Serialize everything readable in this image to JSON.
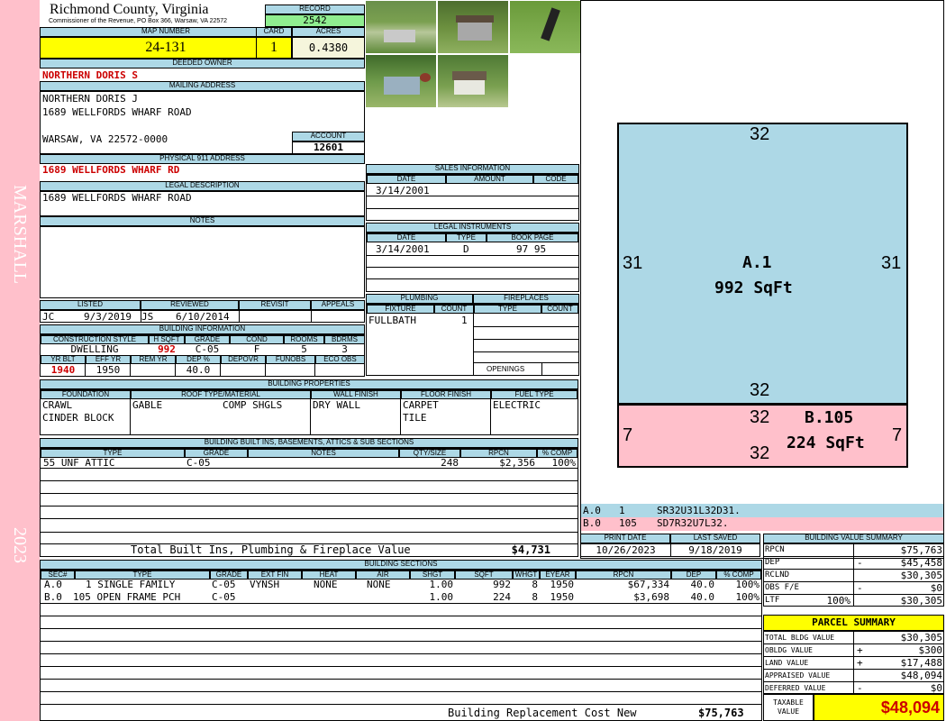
{
  "sidebar": {
    "owner_name": "MARSHALL",
    "year": "2023"
  },
  "header": {
    "county": "Richmond County, Virginia",
    "commissioner": "Commissioner of the Revenue, PO Box 366, Warsaw, VA 22572",
    "record_label": "RECORD",
    "record": "2542",
    "map_label": "MAP NUMBER",
    "map_number": "24-131",
    "card_label": "CARD",
    "card": "1",
    "acres_label": "ACRES",
    "acres": "0.4380"
  },
  "owner": {
    "deeded_label": "DEEDED OWNER",
    "deeded_owner": "NORTHERN DORIS S",
    "mailing_label": "MAILING ADDRESS",
    "mailing": [
      "NORTHERN DORIS J",
      "1689 WELLFORDS WHARF ROAD",
      "",
      "WARSAW, VA 22572-0000"
    ],
    "account_label": "ACCOUNT",
    "account": "12601",
    "physical_label": "PHYSICAL 911 ADDRESS",
    "physical": "1689 WELLFORDS WHARF RD",
    "legal_label": "LEGAL DESCRIPTION",
    "legal": "1689 WELLFORDS WHARF ROAD",
    "notes_label": "NOTES"
  },
  "review": {
    "listed_label": "LISTED",
    "reviewed_label": "REVIEWED",
    "revisit_label": "REVISIT",
    "appeals_label": "APPEALS",
    "listed_by": "JC",
    "listed_date": "9/3/2019",
    "reviewed_by": "JS",
    "reviewed_date": "6/10/2014"
  },
  "building_info": {
    "title": "BUILDING INFORMATION",
    "headers": [
      "CONSTRUCTION STYLE",
      "H SQFT",
      "GRADE",
      "COND",
      "ROOMS",
      "BDRMS"
    ],
    "values": [
      "DWELLING",
      "992",
      "C-05",
      "F",
      "5",
      "3"
    ],
    "headers2": [
      "YR BLT",
      "EFF YR",
      "REM YR",
      "DEP %",
      "DEPOVR",
      "FUNOBS",
      "ECO OBS"
    ],
    "values2": [
      "1940",
      "1950",
      "",
      "40.0",
      "",
      "",
      ""
    ]
  },
  "sales": {
    "title": "SALES INFORMATION",
    "headers": [
      "DATE",
      "AMOUNT",
      "CODE"
    ],
    "rows": [
      [
        "3/14/2001",
        "",
        ""
      ]
    ]
  },
  "legal_instruments": {
    "title": "LEGAL INSTRUMENTS",
    "headers": [
      "DATE",
      "TYPE",
      "BOOK PAGE"
    ],
    "rows": [
      [
        "3/14/2001",
        "D",
        "97 95"
      ]
    ]
  },
  "plumbing": {
    "title": "PLUMBING",
    "headers": [
      "FIXTURE",
      "COUNT"
    ],
    "rows": [
      [
        "FULLBATH",
        "1"
      ]
    ]
  },
  "fireplaces": {
    "title": "FIREPLACES",
    "headers": [
      "TYPE",
      "COUNT"
    ],
    "openings_label": "OPENINGS"
  },
  "properties": {
    "title": "BUILDING PROPERTIES",
    "headers": [
      "FOUNDATION",
      "ROOF TYPE/MATERIAL",
      "WALL FINISH",
      "FLOOR FINISH",
      "FUEL TYPE"
    ],
    "foundation": [
      "CRAWL",
      "CINDER BLOCK"
    ],
    "roof_type": "GABLE",
    "roof_material": "COMP SHGLS",
    "wall": "DRY WALL",
    "floor": [
      "CARPET",
      "TILE"
    ],
    "fuel": "ELECTRIC"
  },
  "builtins": {
    "title": "BUILDING BUILT INS, BASEMENTS, ATTICS & SUB SECTIONS",
    "headers": [
      "TYPE",
      "GRADE",
      "NOTES",
      "QTY/SIZE",
      "RPCN",
      "% COMP"
    ],
    "rows": [
      [
        "55 UNF ATTIC",
        "C-05",
        "",
        "248",
        "$2,356",
        "100%"
      ]
    ],
    "total_label": "Total Built Ins, Plumbing & Fireplace Value",
    "total": "$4,731"
  },
  "sections": {
    "title": "BUILDING SECTIONS",
    "headers": [
      "SEC#",
      "TYPE",
      "GRADE",
      "EXT FIN",
      "HEAT",
      "AIR",
      "SHGT",
      "SQFT",
      "WHGT",
      "EYEAR",
      "RPCN",
      "DEP",
      "% COMP"
    ],
    "rows": [
      [
        "A.0",
        "1 SINGLE FAMILY",
        "C-05",
        "VYNSH",
        "NONE",
        "NONE",
        "1.00",
        "992",
        "8",
        "1950",
        "$67,334",
        "40.0",
        "100%"
      ],
      [
        "B.0",
        "105 OPEN FRAME PCH",
        "C-05",
        "",
        "",
        "",
        "1.00",
        "224",
        "8",
        "1950",
        "$3,698",
        "40.0",
        "100%"
      ]
    ],
    "replacement_label": "Building Replacement Cost New",
    "replacement": "$75,763"
  },
  "sketch": {
    "A": {
      "label": "A.1",
      "area": "992 SqFt",
      "top": "32",
      "left": "31",
      "right": "31",
      "bottom": "32",
      "color": "#add8e6"
    },
    "B": {
      "label": "B.105",
      "area": "224 SqFt",
      "top": "32",
      "left": "7",
      "right": "7",
      "bottom": "32",
      "color": "#ffc0cb"
    },
    "codes": [
      [
        "A.0",
        "1",
        "SR32U31L32D31."
      ],
      [
        "B.0",
        "105",
        "SD7R32U7L32."
      ]
    ]
  },
  "print": {
    "print_label": "PRINT DATE",
    "saved_label": "LAST SAVED",
    "print_date": "10/26/2023",
    "last_saved": "9/18/2019"
  },
  "value_summary": {
    "title": "BUILDING VALUE SUMMARY",
    "rows": [
      [
        "RPCN",
        "",
        "$75,763"
      ],
      [
        "DEP",
        "-",
        "$45,458"
      ],
      [
        "RCLND",
        "",
        "$30,305"
      ],
      [
        "OBS F/E",
        "-",
        "$0"
      ],
      [
        "LTF",
        "100%",
        "$30,305"
      ]
    ]
  },
  "parcel": {
    "title": "PARCEL SUMMARY",
    "rows": [
      [
        "TOTAL BLDG VALUE",
        "",
        "$30,305"
      ],
      [
        "OBLDG VALUE",
        "+",
        "$300"
      ],
      [
        "LAND VALUE",
        "+",
        "$17,488"
      ],
      [
        "APPRAISED VALUE",
        "",
        "$48,094"
      ],
      [
        "DEFERRED VALUE",
        "-",
        "$0"
      ]
    ],
    "taxable_label": "TAXABLE VALUE",
    "taxable": "$48,094"
  },
  "colors": {
    "pink": "#ffc0cb",
    "blue_header": "#add8e6",
    "yellow": "#ffff00",
    "green": "#90ee90",
    "red": "#cc0000"
  }
}
